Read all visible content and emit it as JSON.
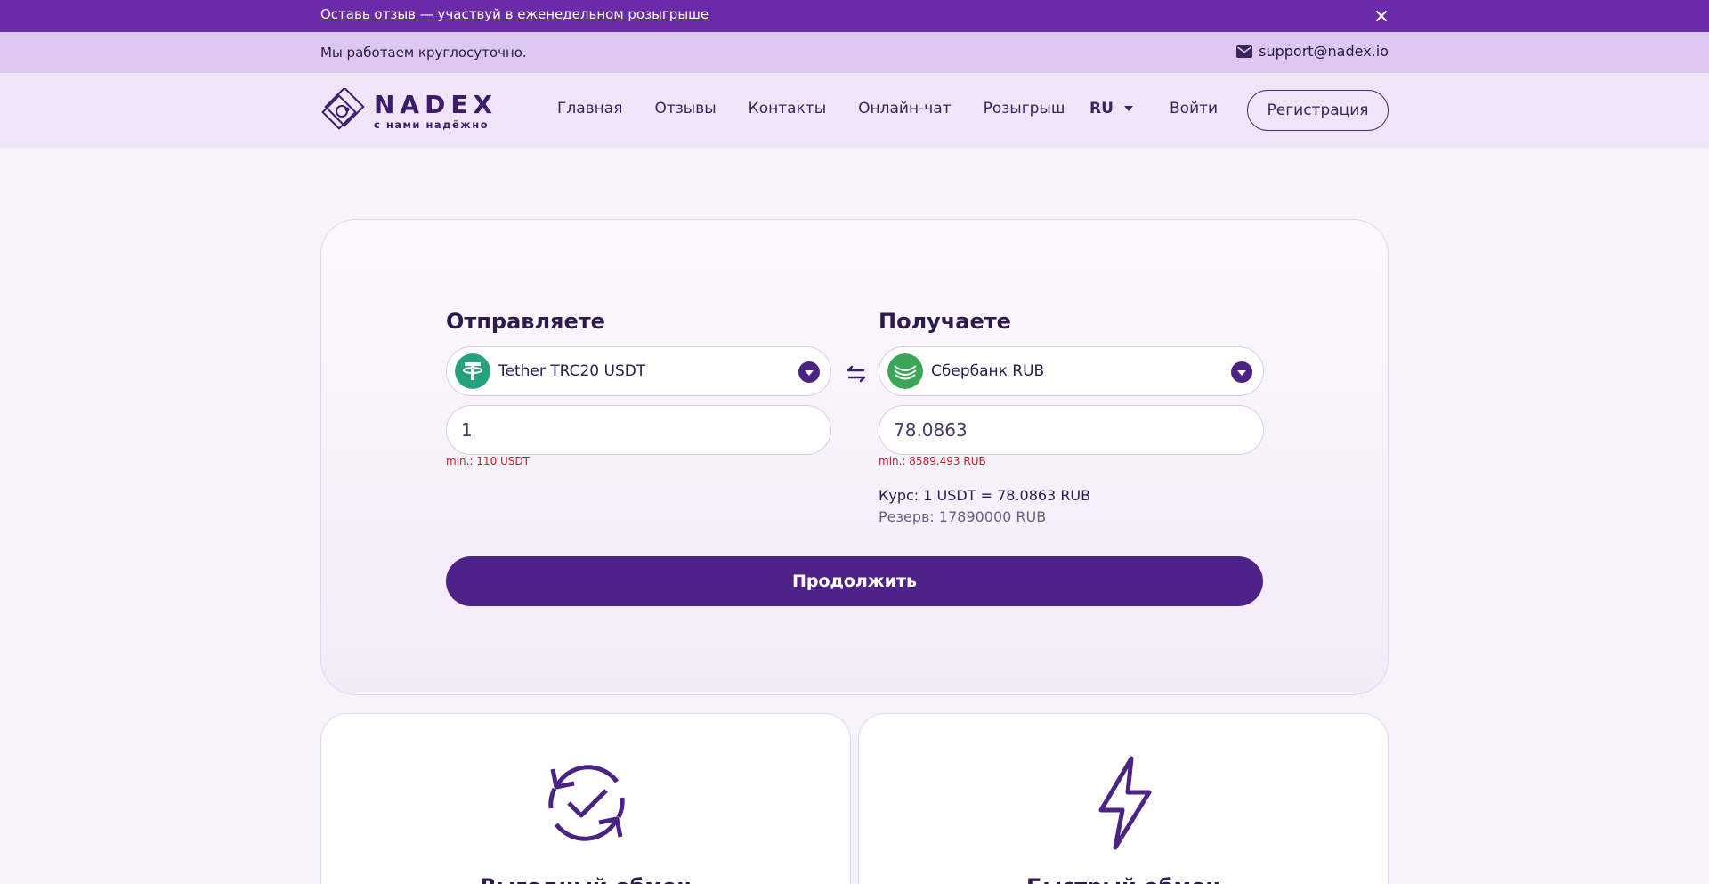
{
  "promo": {
    "link_text": "Оставь отзыв — участвуй в еженедельном розыгрыше"
  },
  "infobar": {
    "text": "Мы работаем круглосуточно.",
    "email": "support@nadex.io"
  },
  "header": {
    "brand": "NADEX",
    "tagline": "с нами надёжно",
    "nav": [
      "Главная",
      "Отзывы",
      "Контакты",
      "Онлайн-чат",
      "Розыгрыш"
    ],
    "lang": "RU",
    "login": "Войти",
    "register": "Регистрация"
  },
  "exchange": {
    "send_title": "Отправляете",
    "receive_title": "Получаете",
    "send_currency": "Tether TRC20 USDT",
    "receive_currency": "Сбербанк RUB",
    "send_amount": "1",
    "receive_amount": "78.0863",
    "send_min": "min.: 110 USDT",
    "receive_min": "min.: 8589.493 RUB",
    "rate": "Курс: 1 USDT = 78.0863 RUB",
    "reserve": "Резерв: 17890000 RUB",
    "continue": "Продолжить"
  },
  "features": [
    {
      "icon": "refresh-check-icon",
      "title": "Выгодный обмен"
    },
    {
      "icon": "lightning-icon",
      "title": "Быстрый обмен"
    }
  ],
  "colors": {
    "promo_bg": "#6a2aaa",
    "info_bg": "#dcc7ef",
    "accent": "#4e2388",
    "error": "#c01d2a",
    "tether": "#26a17b",
    "sber": "#3aa757"
  }
}
